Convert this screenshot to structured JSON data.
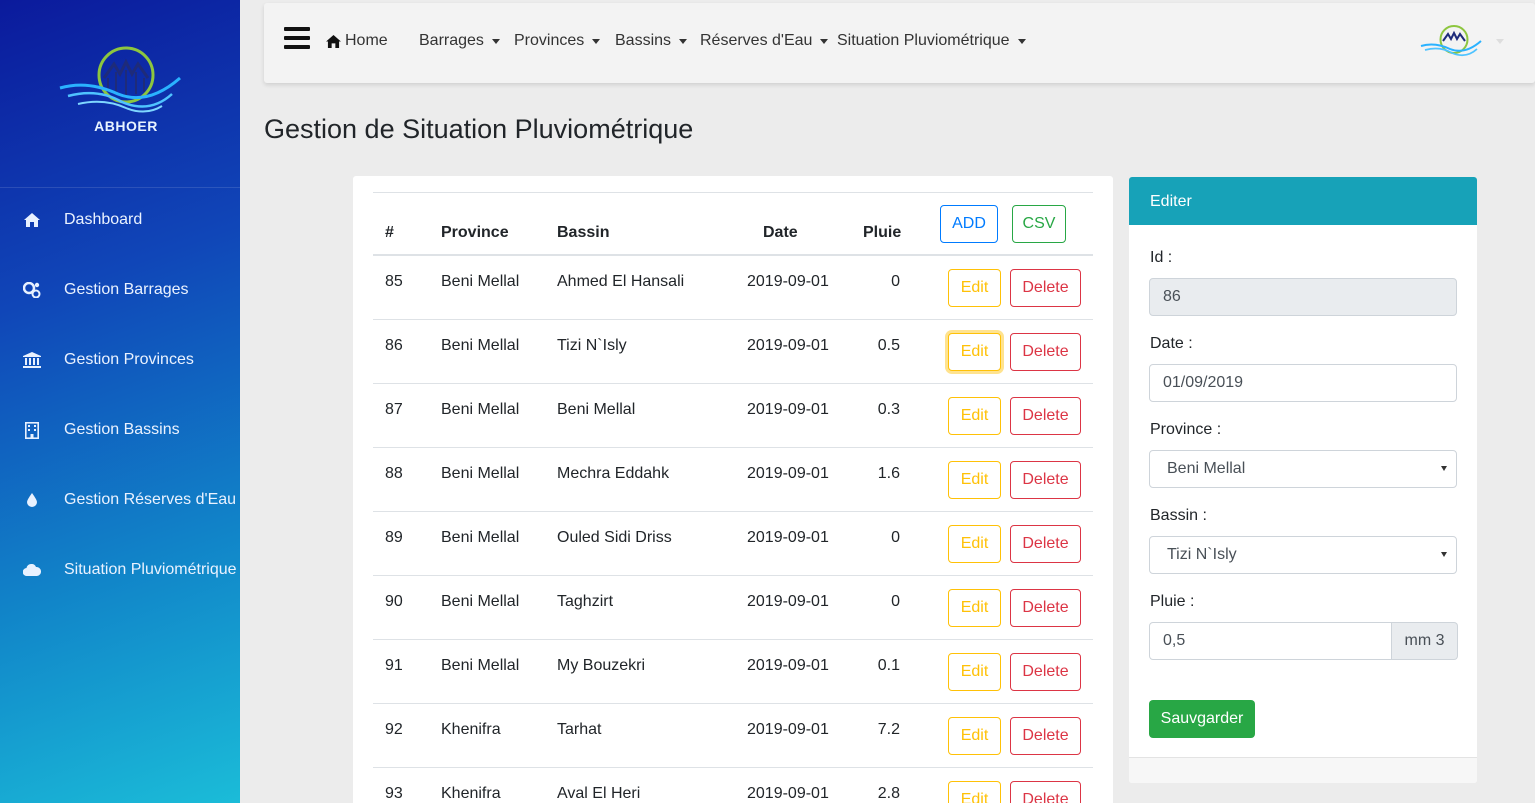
{
  "brand": {
    "name": "ABHOER"
  },
  "sidebar": {
    "items": [
      {
        "label": "Dashboard",
        "icon": "home-icon"
      },
      {
        "label": "Gestion Barrages",
        "icon": "gears-icon"
      },
      {
        "label": "Gestion Provinces",
        "icon": "bank-icon"
      },
      {
        "label": "Gestion Bassins",
        "icon": "building-icon"
      },
      {
        "label": "Gestion Réserves d'Eau",
        "icon": "droplet-icon"
      },
      {
        "label": "Situation Pluviométrique",
        "icon": "cloud-icon"
      }
    ]
  },
  "topnav": {
    "home": "Home",
    "menus": [
      "Barrages",
      "Provinces",
      "Bassins",
      "Réserves d'Eau",
      "Situation Pluviométrique"
    ]
  },
  "page": {
    "title": "Gestion de Situation Pluviométrique"
  },
  "table": {
    "headers": {
      "id": "#",
      "province": "Province",
      "bassin": "Bassin",
      "date": "Date",
      "pluie": "Pluie"
    },
    "add_label": "ADD",
    "csv_label": "CSV",
    "edit_label": "Edit",
    "delete_label": "Delete",
    "rows": [
      {
        "id": "85",
        "province": "Beni Mellal",
        "bassin": "Ahmed El Hansali",
        "date": "2019-09-01",
        "pluie": "0"
      },
      {
        "id": "86",
        "province": "Beni Mellal",
        "bassin": "Tizi N`Isly",
        "date": "2019-09-01",
        "pluie": "0.5"
      },
      {
        "id": "87",
        "province": "Beni Mellal",
        "bassin": "Beni Mellal",
        "date": "2019-09-01",
        "pluie": "0.3"
      },
      {
        "id": "88",
        "province": "Beni Mellal",
        "bassin": "Mechra Eddahk",
        "date": "2019-09-01",
        "pluie": "1.6"
      },
      {
        "id": "89",
        "province": "Beni Mellal",
        "bassin": "Ouled Sidi Driss",
        "date": "2019-09-01",
        "pluie": "0"
      },
      {
        "id": "90",
        "province": "Beni Mellal",
        "bassin": "Taghzirt",
        "date": "2019-09-01",
        "pluie": "0"
      },
      {
        "id": "91",
        "province": "Beni Mellal",
        "bassin": "My Bouzekri",
        "date": "2019-09-01",
        "pluie": "0.1"
      },
      {
        "id": "92",
        "province": "Khenifra",
        "bassin": "Tarhat",
        "date": "2019-09-01",
        "pluie": "7.2"
      },
      {
        "id": "93",
        "province": "Khenifra",
        "bassin": "Aval El Heri",
        "date": "2019-09-01",
        "pluie": "2.8"
      }
    ]
  },
  "edit_form": {
    "title": "Editer",
    "id_label": "Id :",
    "id_value": "86",
    "date_label": "Date :",
    "date_value": "01/09/2019",
    "province_label": "Province :",
    "province_value": "Beni Mellal",
    "bassin_label": "Bassin :",
    "bassin_value": "Tizi N`Isly",
    "pluie_label": "Pluie :",
    "pluie_value": "0,5",
    "pluie_unit": "mm 3",
    "save_label": "Sauvgarder"
  },
  "colors": {
    "primary": "#007bff",
    "success": "#28a745",
    "warning": "#ffc107",
    "danger": "#dc3545",
    "info": "#17a2b8"
  }
}
